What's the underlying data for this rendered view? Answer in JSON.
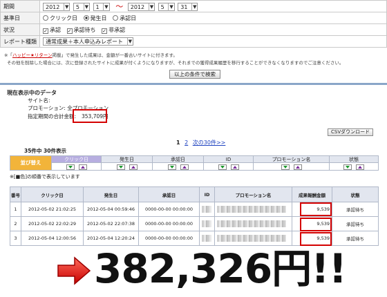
{
  "filters": {
    "period_label": "期間",
    "from": {
      "year": "2012",
      "month": "5",
      "day": "1"
    },
    "tilde": "～",
    "to": {
      "year": "2012",
      "month": "5",
      "day": "31"
    },
    "basis_label": "基準日",
    "basis_options": [
      "クリック日",
      "発生日",
      "承認日"
    ],
    "basis_selected": "発生日",
    "status_label": "状況",
    "status_options": [
      "承認",
      "承認待ち",
      "非承認"
    ],
    "report_label": "レポート種類",
    "report_value": "通常成果＋本人申込みレポート"
  },
  "notes": {
    "line1_prefix": "※「",
    "line1_link": "ハッピー★リターン",
    "line1_rest": "掲載」で発生した成果は、金額が一番古いサイトに付きます。",
    "line2": "その他を削除した場合には、次に登録されたサイトに成果が付くようになりますが、それまでの獲得成果履歴を移行することができなくなりますのでご注意ください。"
  },
  "search_button": "以上の条件で検索",
  "current": {
    "title": "現在表示中のデータ",
    "site_label": "サイト名:",
    "promo_label": "プロモーション: 全プロモーション",
    "total_label": "指定期間の合計金額:",
    "total_value": "353,709円"
  },
  "csv_button": "CSVダウンロード",
  "pager": {
    "current": "1",
    "next_page": "2",
    "next_link": "次の30件>>"
  },
  "count_text": "35件中  30件表示",
  "sort": {
    "button": "並び替え",
    "columns": [
      "クリック日",
      "発生日",
      "承認日",
      "ID",
      "プロモーション名",
      "状態"
    ],
    "note": "※[■色]の順番で表示しています"
  },
  "table": {
    "headers": [
      "番号",
      "クリック日",
      "発生日",
      "承認日",
      "ID",
      "プロモーション名",
      "成果報酬金額",
      "状態"
    ],
    "rows": [
      {
        "no": "1",
        "click": "2012-05-02 21:02:25",
        "occur": "2012-05-04 00:59:46",
        "approve": "0000-00-00 00:00:00",
        "amount": "9,539",
        "status": "承認待ち"
      },
      {
        "no": "2",
        "click": "2012-05-02 22:02:29",
        "occur": "2012-05-02 22:07:38",
        "approve": "0000-00-00 00:00:00",
        "amount": "9,539",
        "status": "承認待ち"
      },
      {
        "no": "3",
        "click": "2012-05-04 12:00:56",
        "occur": "2012-05-04 12:20:24",
        "approve": "0000-00-00 00:00:00",
        "amount": "9,539",
        "status": "承認待ち"
      }
    ]
  },
  "headline": "382,326円!!",
  "colors": {
    "accent_red": "#d40000",
    "sort_orange": "#f2b43a",
    "header_bg": "#e2e6ef"
  }
}
